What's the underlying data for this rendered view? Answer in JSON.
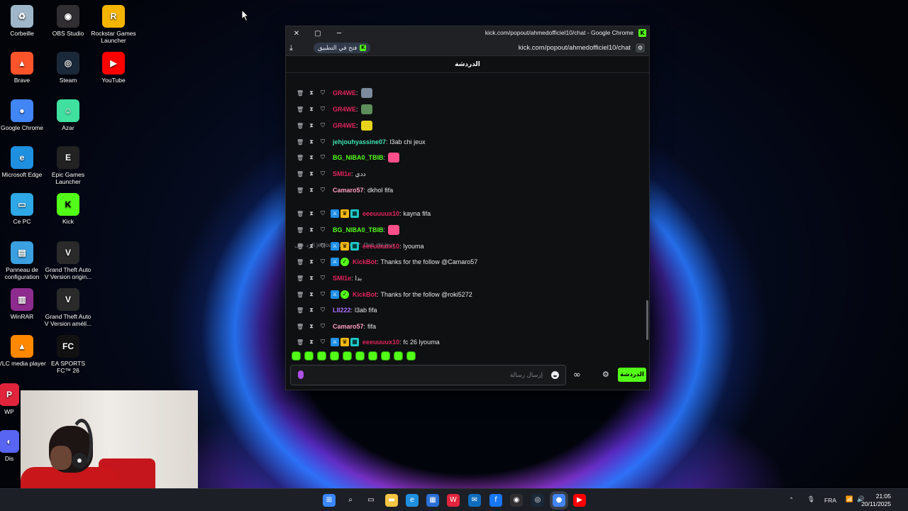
{
  "desktop": {
    "icons": [
      {
        "label": "Corbeille",
        "icon": "recycle-bin-icon",
        "color": "#9fb7c9",
        "glyph": "♻"
      },
      {
        "label": "OBS Studio",
        "icon": "obs-icon",
        "color": "#302e31",
        "glyph": "◉"
      },
      {
        "label": "Rockstar Games Launcher",
        "icon": "rockstar-icon",
        "color": "#f4b400",
        "glyph": "R"
      },
      {
        "label": "Brave",
        "icon": "brave-icon",
        "color": "#fb542b",
        "glyph": "▲"
      },
      {
        "label": "Steam",
        "icon": "steam-icon",
        "color": "#1b2838",
        "glyph": "◎"
      },
      {
        "label": "YouTube",
        "icon": "youtube-icon",
        "color": "#ff0000",
        "glyph": "▶"
      },
      {
        "label": "Google Chrome",
        "icon": "chrome-icon",
        "color": "#4285f4",
        "glyph": "●"
      },
      {
        "label": "Azar",
        "icon": "azar-icon",
        "color": "#3fe0a0",
        "glyph": "☺"
      },
      {
        "label": "Microsoft Edge",
        "icon": "edge-icon",
        "color": "#1f8fe0",
        "glyph": "e"
      },
      {
        "label": "Epic Games Launcher",
        "icon": "epic-games-icon",
        "color": "#222222",
        "glyph": "E"
      },
      {
        "label": "Ce PC",
        "icon": "this-pc-icon",
        "color": "#2ea8e6",
        "glyph": "▭"
      },
      {
        "label": "Kick",
        "icon": "kick-icon",
        "color": "#53fc18",
        "glyph": "K"
      },
      {
        "label": "Panneau de configuration",
        "icon": "control-panel-icon",
        "color": "#3aa0e0",
        "glyph": "▤"
      },
      {
        "label": "Grand Theft Auto V Version origin...",
        "icon": "gta-v-icon",
        "color": "#2a2a2a",
        "glyph": "V"
      },
      {
        "label": "WinRAR",
        "icon": "winrar-icon",
        "color": "#8e2b8e",
        "glyph": "▥"
      },
      {
        "label": "Grand Theft Auto V Version améli...",
        "icon": "gta-v-enhanced-icon",
        "color": "#2a2a2a",
        "glyph": "V"
      },
      {
        "label": "VLC media player",
        "icon": "vlc-icon",
        "color": "#ff8800",
        "glyph": "▲"
      },
      {
        "label": "EA SPORTS FC™ 26",
        "icon": "ea-fc-icon",
        "color": "#111111",
        "glyph": "FC"
      }
    ],
    "partial_icons": [
      {
        "label": "WP",
        "icon": "wps-icon"
      },
      {
        "label": "Dis",
        "icon": "discord-icon"
      }
    ]
  },
  "window": {
    "title": "kick.com/popout/ahmedofficiel10/chat - Google Chrome",
    "url": "kick.com/popout/ahmedofficiel10/chat",
    "open_in_app": "فتح في التطبيق",
    "chat_title": "الدردشة"
  },
  "chat": {
    "messages": [
      {
        "user": "GR4WE",
        "color": "#e0245e",
        "text": "",
        "badges": [],
        "emote": "#7b8a9c"
      },
      {
        "user": "GR4WE",
        "color": "#e0245e",
        "text": "",
        "badges": [],
        "emote": "#5c8f5a"
      },
      {
        "user": "GR4WE",
        "color": "#e0245e",
        "text": "",
        "badges": [],
        "emote": "#e8d31b"
      },
      {
        "user": "jehjouhyassine07",
        "color": "#3de3b0",
        "text": "l3ab chi jeux",
        "badges": []
      },
      {
        "user": "BG_NIBA0_TBIB",
        "color": "#53fc18",
        "text": "",
        "badges": [],
        "emote": "#ff4f8a"
      },
      {
        "user": "SMI1e",
        "color": "#e0245e",
        "text": "ددي",
        "badges": []
      },
      {
        "user": "Camaro57",
        "color": "#ff9ec2",
        "text": "dkhol fifa",
        "badges": []
      },
      {
        "user": "eeeuuuux10",
        "color": "#e0245e",
        "text": "kayna fifa",
        "badges": [
          "mod",
          "vip",
          "sub"
        ]
      },
      {
        "user": "BG_NIBA0_TBIB",
        "color": "#53fc18",
        "text": "",
        "badges": [],
        "emote": "#ff4f8a"
      },
      {
        "user": "eeeuuuux10",
        "color": "#e0245e",
        "text": "lyouma",
        "badges": [
          "mod",
          "vip",
          "sub"
        ]
      },
      {
        "user": "KickBot",
        "color": "#e0245e",
        "text": "Thanks for the follow @Camaro57",
        "badges": [
          "mod",
          "verified"
        ]
      },
      {
        "user": "SMI1e",
        "color": "#e0245e",
        "text": "بدا",
        "badges": []
      },
      {
        "user": "KickBot",
        "color": "#e0245e",
        "text": "Thanks for the follow @roki5272",
        "badges": [
          "mod",
          "verified"
        ]
      },
      {
        "user": "LII222",
        "color": "#a970ff",
        "text": "l3ab fifa",
        "badges": []
      },
      {
        "user": "Camaro57",
        "color": "#ff9ec2",
        "text": "fifa",
        "badges": []
      },
      {
        "user": "eeeuuuux10",
        "color": "#e0245e",
        "text": "fc 26 lyouma",
        "badges": [
          "mod",
          "vip",
          "sub"
        ]
      }
    ],
    "reply_preview": "الرد على jehjouhyassine07: l3ab chi jeux",
    "input_placeholder": "إرسال رسالة",
    "send_label": "الدردشة"
  },
  "taskbar": {
    "apps": [
      "start-icon",
      "search-icon",
      "task-view-icon",
      "file-explorer-icon",
      "edge-icon",
      "store-icon",
      "wps-icon",
      "outlook-icon",
      "facebook-icon",
      "obs-icon",
      "steam-icon",
      "chrome-icon",
      "youtube-icon"
    ],
    "language": "FRA",
    "time": "21:05",
    "date": "20/11/2025"
  },
  "colors": {
    "accent": "#53fc18",
    "chat_bg": "#0f1011"
  }
}
